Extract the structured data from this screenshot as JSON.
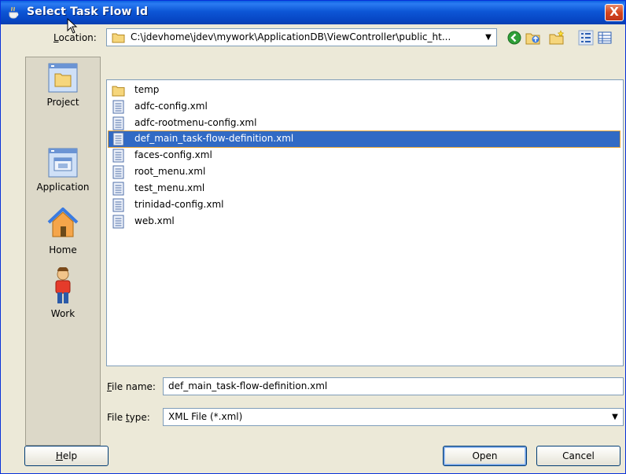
{
  "window": {
    "title": "Select Task Flow Id",
    "close_glyph": "X"
  },
  "location": {
    "label_underlined": "L",
    "label_rest": "ocation:",
    "path": "C:\\jdevhome\\jdev\\mywork\\ApplicationDB\\ViewController\\public_ht...",
    "dropdown_glyph": "▼"
  },
  "toolbar": {
    "icons": [
      "back-icon",
      "up-folder-icon",
      "new-folder-icon",
      "list-view-icon",
      "details-view-icon"
    ]
  },
  "places": [
    {
      "label": "Project",
      "icon": "project-icon"
    },
    {
      "label": "Application",
      "icon": "application-icon"
    },
    {
      "label": "Home",
      "icon": "home-icon"
    },
    {
      "label": "Work",
      "icon": "work-icon"
    }
  ],
  "files": [
    {
      "name": "temp",
      "type": "folder",
      "selected": false
    },
    {
      "name": "adfc-config.xml",
      "type": "file",
      "selected": false
    },
    {
      "name": "adfc-rootmenu-config.xml",
      "type": "file",
      "selected": false
    },
    {
      "name": "def_main_task-flow-definition.xml",
      "type": "file",
      "selected": true
    },
    {
      "name": "faces-config.xml",
      "type": "file",
      "selected": false
    },
    {
      "name": "root_menu.xml",
      "type": "file",
      "selected": false
    },
    {
      "name": "test_menu.xml",
      "type": "file",
      "selected": false
    },
    {
      "name": "trinidad-config.xml",
      "type": "file",
      "selected": false
    },
    {
      "name": "web.xml",
      "type": "file",
      "selected": false
    }
  ],
  "filename": {
    "label_underlined": "F",
    "label_rest": "ile name:",
    "value": "def_main_task-flow-definition.xml"
  },
  "filetype": {
    "label_start": "File ",
    "label_underlined": "t",
    "label_rest": "ype:",
    "value": "XML File (*.xml)",
    "dropdown_glyph": "▼"
  },
  "buttons": {
    "help_underlined": "H",
    "help_rest": "elp",
    "open": "Open",
    "cancel": "Cancel"
  },
  "colors": {
    "titlebar": "#0a5fe0",
    "selection": "#316ac5",
    "dialog_bg": "#ece9d8"
  }
}
